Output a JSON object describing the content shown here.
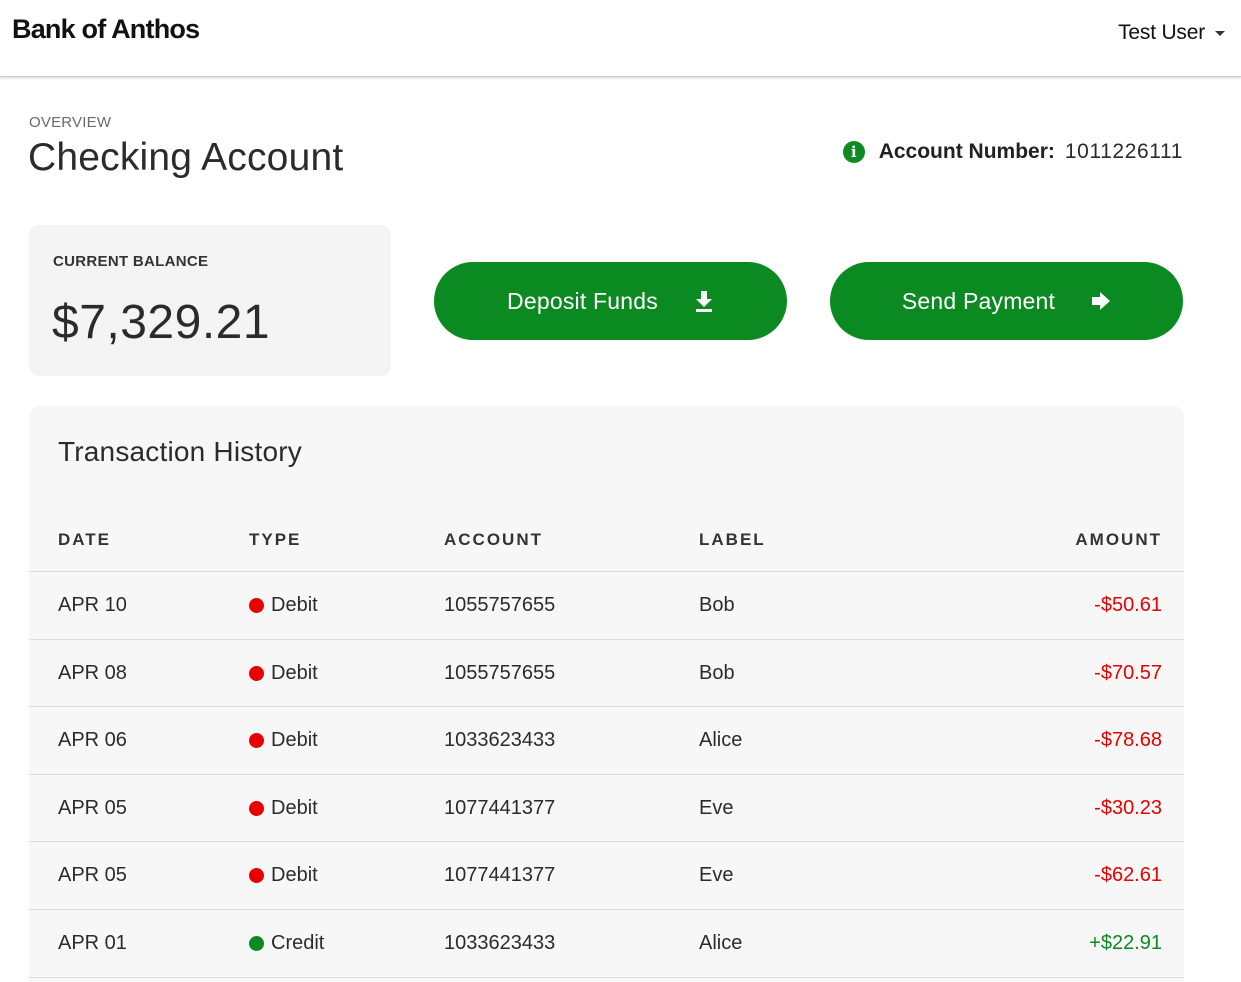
{
  "header": {
    "brand": "Bank of Anthos",
    "user_name": "Test User",
    "icons": {
      "user_menu": "caret-down-icon"
    }
  },
  "overview": {
    "label": "OVERVIEW",
    "title": "Checking Account",
    "account_number_label": "Account Number:",
    "account_number": "1011226111",
    "info_icon": "info-icon"
  },
  "balance": {
    "label": "CURRENT BALANCE",
    "value": "$7,329.21"
  },
  "actions": {
    "deposit_label": "Deposit Funds",
    "deposit_icon": "download-icon",
    "send_label": "Send Payment",
    "send_icon": "arrow-right-icon"
  },
  "history": {
    "title": "Transaction History",
    "columns": {
      "date": "DATE",
      "type": "TYPE",
      "account": "ACCOUNT",
      "label": "LABEL",
      "amount": "AMOUNT"
    },
    "rows": [
      {
        "date": "APR 10",
        "type": "Debit",
        "account": "1055757655",
        "label": "Bob",
        "amount": "-$50.61"
      },
      {
        "date": "APR 08",
        "type": "Debit",
        "account": "1055757655",
        "label": "Bob",
        "amount": "-$70.57"
      },
      {
        "date": "APR 06",
        "type": "Debit",
        "account": "1033623433",
        "label": "Alice",
        "amount": "-$78.68"
      },
      {
        "date": "APR 05",
        "type": "Debit",
        "account": "1077441377",
        "label": "Eve",
        "amount": "-$30.23"
      },
      {
        "date": "APR 05",
        "type": "Debit",
        "account": "1077441377",
        "label": "Eve",
        "amount": "-$62.61"
      },
      {
        "date": "APR 01",
        "type": "Credit",
        "account": "1033623433",
        "label": "Alice",
        "amount": "+$22.91"
      }
    ]
  },
  "colors": {
    "brand_green": "#0b8a22",
    "debit": "#e60000",
    "credit": "#0b8a22",
    "card_bg": "#f4f4f4"
  }
}
